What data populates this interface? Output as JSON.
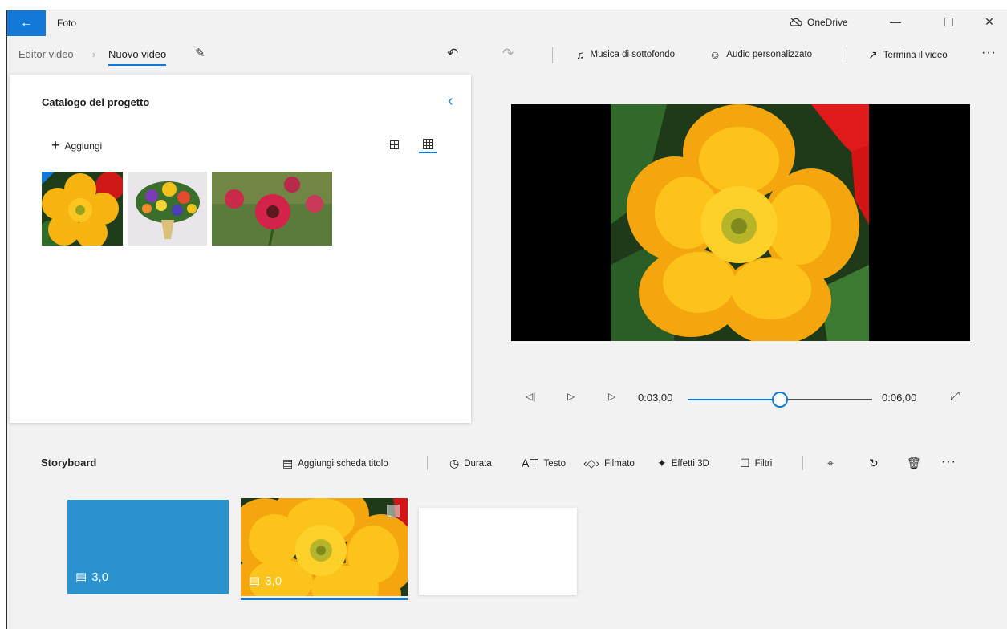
{
  "window": {
    "app_title": "Foto",
    "onedrive_label": "OneDrive"
  },
  "cmdbar": {
    "breadcrumb_root": "Editor video",
    "breadcrumb_current": "Nuovo video",
    "music_label": "Musica di sottofondo",
    "audio_label": "Audio personalizzato",
    "finish_label": "Termina il video"
  },
  "library": {
    "title": "Catalogo del progetto",
    "add_label": "Aggiungi",
    "items": [
      {
        "name": "yellow-flower"
      },
      {
        "name": "flower-bouquet"
      },
      {
        "name": "red-gerbera"
      }
    ]
  },
  "player": {
    "current_time": "0:03,00",
    "total_time": "0:06,00",
    "progress": 0.5
  },
  "storyboard": {
    "title": "Storyboard",
    "tools": {
      "add_title_card": "Aggiungi scheda titolo",
      "duration": "Durata",
      "text": "Testo",
      "motion": "Filmato",
      "effects3d": "Effetti 3D",
      "filters": "Filtri"
    },
    "cards": [
      {
        "type": "title-card",
        "duration": "3,0",
        "color": "#2a93cf"
      },
      {
        "type": "image",
        "duration": "3,0",
        "selected": true
      }
    ]
  },
  "colors": {
    "accent": "#1479d6"
  }
}
